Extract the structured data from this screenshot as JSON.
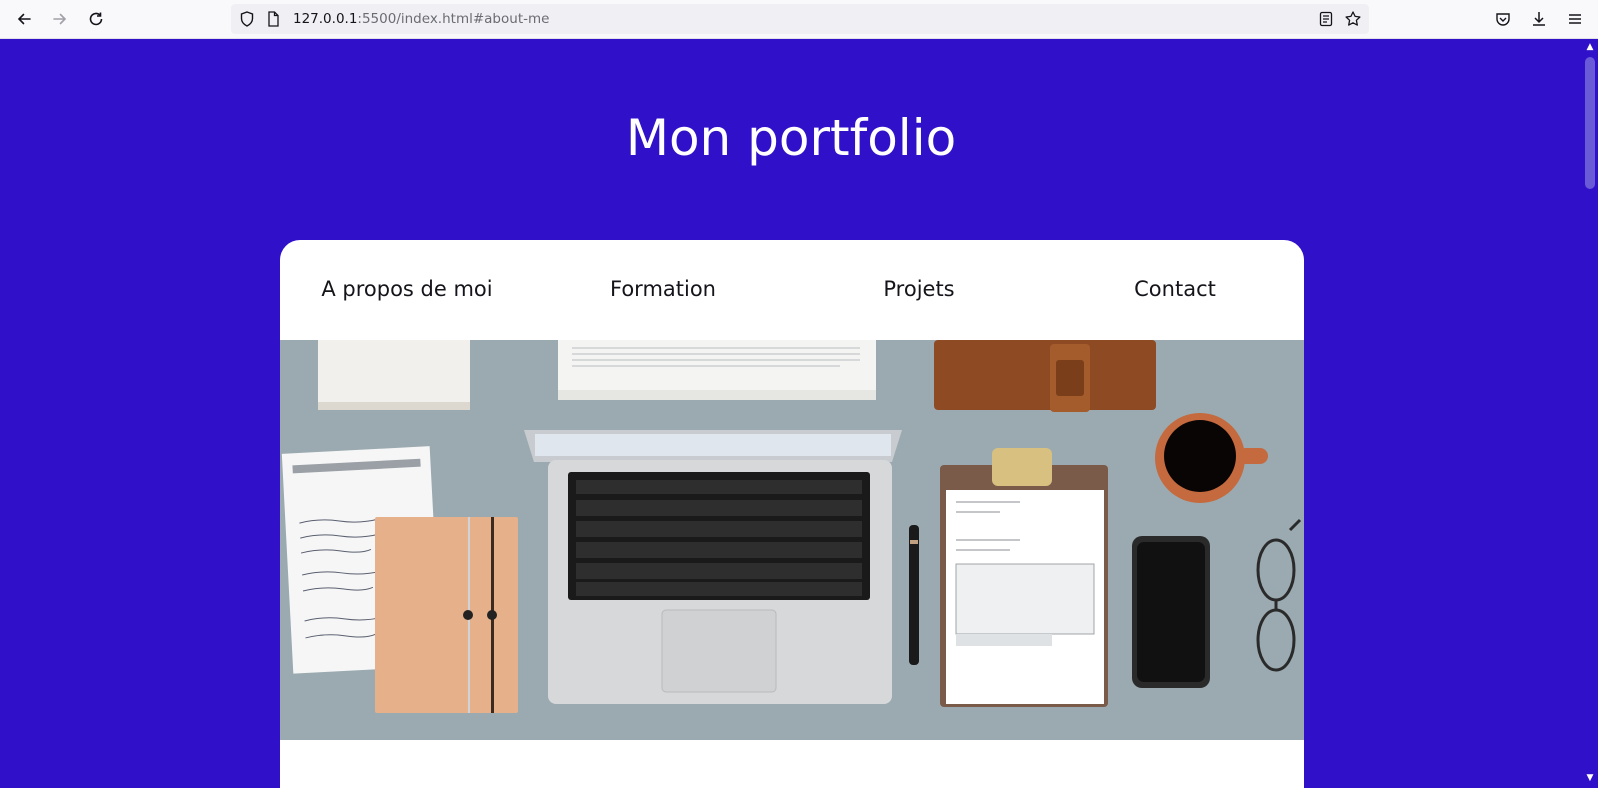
{
  "browser": {
    "url_host": "127.0.0.1",
    "url_rest": ":5500/index.html#about-me",
    "icons": [
      "back-icon",
      "forward-icon",
      "reload-icon",
      "shield-icon",
      "page-icon",
      "reader-view-icon",
      "bookmark-star-icon",
      "pocket-icon",
      "download-icon",
      "menu-icon"
    ]
  },
  "page": {
    "title": "Mon portfolio",
    "background_color": "#3010c8",
    "nav": [
      {
        "label": "A propos de moi"
      },
      {
        "label": "Formation"
      },
      {
        "label": "Projets"
      },
      {
        "label": "Contact"
      }
    ],
    "hero_image": "desk-workspace-photo"
  }
}
